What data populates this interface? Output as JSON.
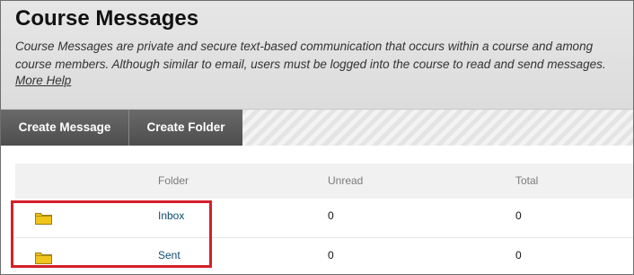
{
  "page": {
    "title": "Course Messages",
    "description": "Course Messages are private and secure text-based communication that occurs within a course and among course members. Although similar to email, users must be logged into the course to read and send messages.",
    "help_link": "More Help"
  },
  "toolbar": {
    "create_message_label": "Create Message",
    "create_folder_label": "Create Folder"
  },
  "table": {
    "columns": [
      "Folder",
      "Unread",
      "Total"
    ],
    "rows": [
      {
        "folder": "Inbox",
        "unread": "0",
        "total": "0",
        "icon": "folder-icon"
      },
      {
        "folder": "Sent",
        "unread": "0",
        "total": "0",
        "icon": "folder-icon"
      }
    ]
  },
  "colors": {
    "highlight": "#d51f29",
    "toolbar_button": "#5a5a5a",
    "link": "#0f4c6e",
    "folder_icon": "#f0c419"
  }
}
